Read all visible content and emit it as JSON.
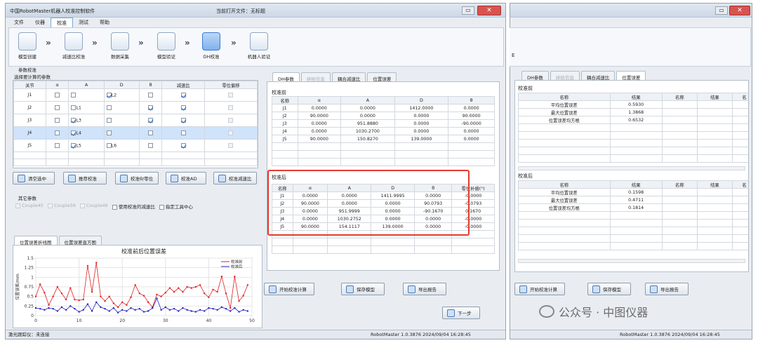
{
  "window": {
    "title": "中国RobotMaster机器人校准控制软件",
    "current_file_label": "当前打开文件：无标题",
    "close": "✕",
    "minimize": "▭"
  },
  "menu": [
    "文件",
    "仪器",
    "校准",
    "测试",
    "帮助"
  ],
  "steps": [
    "模型创建",
    "减速比校准",
    "数据采集",
    "模型验证",
    "DH校准",
    "机器人验证"
  ],
  "left": {
    "param_group": "参数校准",
    "select_label": "选择要计算的参数",
    "headers": [
      "关节",
      "α",
      "A",
      "D",
      "θ",
      "减速比",
      "零位偏移"
    ],
    "rows": [
      {
        "j": "J1",
        "a": false,
        "A": false,
        "Al": "",
        "D": true,
        "Dl": "L2",
        "t": false,
        "r": true,
        "z": false
      },
      {
        "j": "J2",
        "a": false,
        "A": false,
        "Al": "L1",
        "D": false,
        "Dl": "",
        "t": true,
        "r": true,
        "z": false
      },
      {
        "j": "J3",
        "a": false,
        "A": true,
        "Al": "L3",
        "D": false,
        "Dl": "",
        "t": true,
        "r": true,
        "z": false
      },
      {
        "j": "J4",
        "a": false,
        "A": true,
        "Al": "L4",
        "D": false,
        "Dl": "",
        "t": false,
        "r": false,
        "z": false
      },
      {
        "j": "J5",
        "a": false,
        "A": true,
        "Al": "L5",
        "D": false,
        "Dl": "L6",
        "t": false,
        "r": true,
        "z": false
      }
    ],
    "buttons": [
      "清空选中",
      "推荐校准",
      "校准θ/零位",
      "校准AD",
      "校准减速比"
    ],
    "other_group": "其它参数",
    "others": [
      "Couple45",
      "Couple56",
      "Couple46",
      "使用校准的减速比",
      "指定工具中心"
    ],
    "chart_tabs": [
      "位置误差折线图",
      "位置误差直方图"
    ]
  },
  "chart_data": {
    "type": "line",
    "title": "校准前后位置误差",
    "ylabel": "位置误差/mm",
    "xlim": [
      0,
      50
    ],
    "ylim": [
      0,
      1.5
    ],
    "xticks": [
      0,
      10,
      20,
      30,
      40,
      50
    ],
    "yticks": [
      0,
      0.25,
      0.5,
      0.75,
      1,
      1.25,
      1.5
    ],
    "xtick_labels": [
      "0",
      "10",
      "20",
      "30",
      "40",
      "50"
    ],
    "ytick_labels": [
      "0",
      "0.25",
      "0.5",
      "0.75",
      "1",
      "1.25",
      "1.5"
    ],
    "legend_position": "top-right",
    "series": [
      {
        "name": "校准前",
        "color": "#e02020",
        "values": [
          0.5,
          0.82,
          0.6,
          0.28,
          0.5,
          0.75,
          0.58,
          0.42,
          0.72,
          0.42,
          0.4,
          0.42,
          1.3,
          0.62,
          1.38,
          0.5,
          0.38,
          0.5,
          0.32,
          0.22,
          0.35,
          0.28,
          0.48,
          0.8,
          0.58,
          0.52,
          0.35,
          0.22,
          0.55,
          0.5,
          0.6,
          0.72,
          0.62,
          0.72,
          0.62,
          0.75,
          0.72,
          0.75,
          0.8,
          0.58,
          0.48,
          0.68,
          0.62,
          1.02,
          0.58,
          0.2,
          1.02,
          0.38,
          0.52,
          0.8
        ]
      },
      {
        "name": "校准后",
        "color": "#2020c0",
        "values": [
          0.2,
          0.18,
          0.15,
          0.2,
          0.18,
          0.12,
          0.22,
          0.15,
          0.25,
          0.18,
          0.1,
          0.15,
          0.3,
          0.12,
          0.35,
          0.22,
          0.18,
          0.12,
          0.2,
          0.08,
          0.15,
          0.12,
          0.2,
          0.15,
          0.18,
          0.1,
          0.12,
          0.2,
          0.45,
          0.15,
          0.22,
          0.15,
          0.18,
          0.12,
          0.2,
          0.15,
          0.12,
          0.1,
          0.15,
          0.12,
          0.2,
          0.18,
          0.15,
          0.22,
          0.18,
          0.12,
          0.2,
          0.1,
          0.15,
          0.12
        ]
      }
    ]
  },
  "mid": {
    "tabs": [
      "DH参数",
      "拼抢信息",
      "耦合减速比",
      "位置误差"
    ],
    "before_label": "校准前",
    "before_headers": [
      "名称",
      "α",
      "A",
      "D",
      "θ"
    ],
    "before_rows": [
      [
        "J1",
        "0.0000",
        "0.0000",
        "1412.0000",
        "0.0000"
      ],
      [
        "J2",
        "90.0000",
        "0.0000",
        "0.0000",
        "90.0000"
      ],
      [
        "J3",
        "0.0000",
        "951.8880",
        "0.0000",
        "-90.0000"
      ],
      [
        "J4",
        "0.0000",
        "1030.2700",
        "0.0000",
        "0.0000"
      ],
      [
        "J5",
        "90.0000",
        "150.8270",
        "139.0000",
        "0.0000"
      ]
    ],
    "after_label": "校准后",
    "after_headers": [
      "名称",
      "α",
      "A",
      "D",
      "θ",
      "零位补偿(°)"
    ],
    "after_rows": [
      [
        "J1",
        "0.0000",
        "0.0000",
        "1411.9995",
        "0.0000",
        "-0.0000"
      ],
      [
        "J2",
        "90.0000",
        "0.0000",
        "0.0000",
        "90.0793",
        "-0.0793"
      ],
      [
        "J3",
        "0.0000",
        "951.9999",
        "0.0000",
        "-90.1670",
        "0.1670"
      ],
      [
        "J4",
        "0.0000",
        "1030.2752",
        "0.0000",
        "0.0000",
        "-0.0000"
      ],
      [
        "J5",
        "90.0000",
        "154.1117",
        "139.0000",
        "0.0000",
        "-0.0000"
      ]
    ],
    "buttons": [
      "开始校准计算",
      "保存模型",
      "导出报告"
    ],
    "next": "下一步"
  },
  "status": {
    "left": "激光跟踪仪：未连接",
    "right": "RobotMaster 1.0.3876 2024/09/04 16:28:45"
  },
  "right": {
    "tabs": [
      "DH参数",
      "拼抢信息",
      "耦合减速比",
      "位置误差"
    ],
    "cut_char": "E",
    "before_label": "校准前",
    "after_label": "校准后",
    "headers": [
      "名称",
      "结果",
      "名称",
      "结果",
      "名"
    ],
    "before_rows": [
      [
        "平均位置误差",
        "0.5930"
      ],
      [
        "最大位置误差",
        "1.3868"
      ],
      [
        "位置误差均方根",
        "0.6532"
      ]
    ],
    "after_rows": [
      [
        "平均位置误差",
        "0.1598"
      ],
      [
        "最大位置误差",
        "0.4711"
      ],
      [
        "位置误差均方根",
        "0.1814"
      ]
    ],
    "buttons": [
      "开始校准计算",
      "保存模型",
      "导出报告"
    ],
    "status": "RobotMaster 1.0.3876 2024/09/04 16:28:45"
  },
  "watermark": "公众号 · 中图仪器"
}
